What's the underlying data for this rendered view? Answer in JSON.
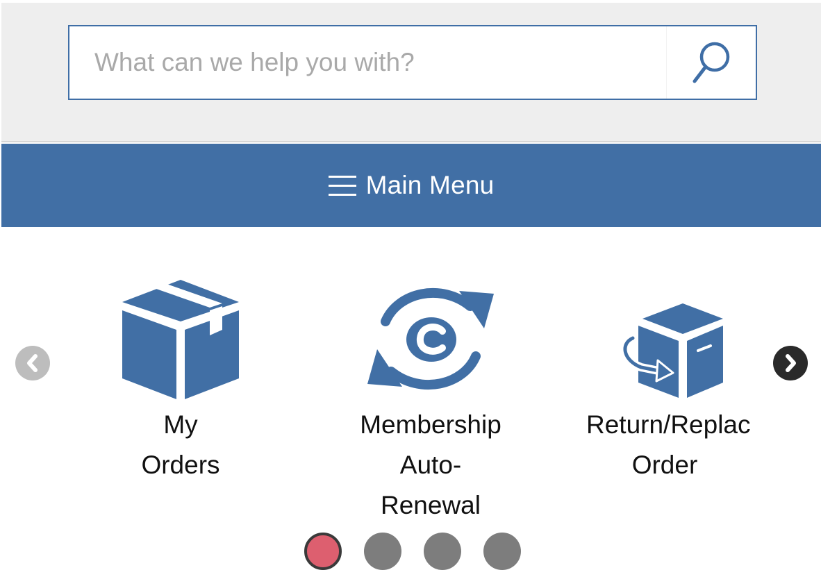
{
  "search": {
    "placeholder": "What can we help you with?",
    "value": "",
    "icon": "search-icon"
  },
  "menu": {
    "label": "Main Menu",
    "icon": "hamburger-icon"
  },
  "carousel": {
    "prev_icon": "chevron-left-icon",
    "next_icon": "chevron-right-icon",
    "items": [
      {
        "line1": "My",
        "line2": "Orders",
        "icon": "package-box-icon"
      },
      {
        "line1": "Membership",
        "line2": "Auto-",
        "line3": "Renewal",
        "icon": "refresh-cycle-icon"
      },
      {
        "line1": "Return/Replac",
        "line2": "Order",
        "icon": "return-box-icon"
      }
    ],
    "page_count": 4,
    "active_page": 1
  },
  "colors": {
    "brand_blue": "#416fa5",
    "active_dot": "#dd5f6f",
    "inactive_dot": "#7d7d7d",
    "search_band_bg": "#eeeeee"
  }
}
